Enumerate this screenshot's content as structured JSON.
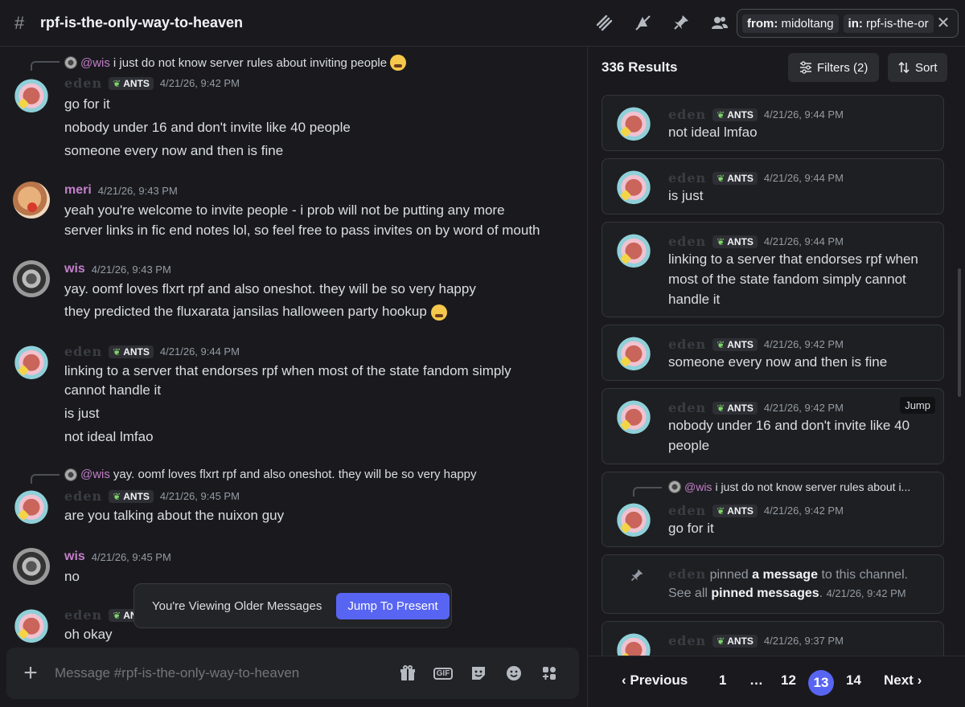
{
  "header": {
    "channel_name": "rpf-is-the-only-way-to-heaven",
    "search_chip_from_label": "from:",
    "search_chip_from_value": "midoltang",
    "search_chip_in_label": "in:",
    "search_chip_in_value": "rpf-is-the-or"
  },
  "chat": {
    "messages": [
      {
        "reply_mention": "@wis",
        "reply_text": "i just do not know server rules about inviting people",
        "author": "eden",
        "tag": "ANTS",
        "timestamp": "4/21/26, 9:42 PM",
        "lines": [
          "go for it",
          "nobody under 16 and don't invite like 40 people",
          "someone every now and then is fine"
        ]
      },
      {
        "author": "meri",
        "timestamp": "4/21/26, 9:43 PM",
        "lines": [
          "yeah you're welcome to invite people - i prob will not be putting any more",
          "server links in fic end notes lol, so feel free to pass invites on by word of mouth"
        ]
      },
      {
        "author": "wis",
        "timestamp": "4/21/26, 9:43 PM",
        "lines": [
          "yay. oomf loves flxrt rpf and also oneshot. they will be so very happy",
          "they predicted the fluxarata jansilas halloween party hookup"
        ]
      },
      {
        "author": "eden",
        "tag": "ANTS",
        "timestamp": "4/21/26, 9:44 PM",
        "lines": [
          "linking to a server that endorses rpf when most of the state fandom simply",
          "cannot handle it",
          "is just",
          "not ideal lmfao"
        ]
      },
      {
        "reply_mention": "@wis",
        "reply_text": "yay. oomf loves flxrt rpf and also oneshot. they will be so very happy",
        "author": "eden",
        "tag": "ANTS",
        "timestamp": "4/21/26, 9:45 PM",
        "lines": [
          "are you talking about the nuixon guy"
        ]
      },
      {
        "author": "wis",
        "timestamp": "4/21/26, 9:45 PM",
        "lines": [
          "no"
        ]
      },
      {
        "author": "eden",
        "tag": "ANT",
        "lines": [
          "oh okay"
        ]
      }
    ],
    "older_notice": "You're Viewing Older Messages",
    "jump_to_present": "Jump To Present",
    "composer_placeholder": "Message #rpf-is-the-only-way-to-heaven",
    "composer_gif": "GIF"
  },
  "results": {
    "count": "336 Results",
    "filters_label": "Filters (2)",
    "sort_label": "Sort",
    "jump_label": "Jump",
    "cards": [
      {
        "author": "eden",
        "tag": "ANTS",
        "timestamp": "4/21/26, 9:44 PM",
        "lines": [
          "not ideal lmfao"
        ]
      },
      {
        "author": "eden",
        "tag": "ANTS",
        "timestamp": "4/21/26, 9:44 PM",
        "lines": [
          "is just"
        ]
      },
      {
        "author": "eden",
        "tag": "ANTS",
        "timestamp": "4/21/26, 9:44 PM",
        "lines": [
          "linking to a server that endorses rpf when",
          "most of the state fandom simply cannot",
          "handle it"
        ]
      },
      {
        "author": "eden",
        "tag": "ANTS",
        "timestamp": "4/21/26, 9:42 PM",
        "lines": [
          "someone every now and then is fine"
        ]
      },
      {
        "author": "eden",
        "tag": "ANTS",
        "timestamp": "4/21/26, 9:42 PM",
        "lines": [
          "nobody under 16 and don't invite like 40",
          "people"
        ]
      },
      {
        "reply_mention": "@wis",
        "reply_text": "i just do not know server rules about i...",
        "author": "eden",
        "tag": "ANTS",
        "timestamp": "4/21/26, 9:42 PM",
        "lines": [
          "go for it"
        ]
      },
      {
        "author": "eden",
        "tag": "ANTS",
        "timestamp": "4/21/26, 9:37 PM",
        "lines": []
      }
    ],
    "pin_card": {
      "actor": "eden",
      "pinned_text": "pinned",
      "message_link": "a message",
      "to_channel": "to this channel.",
      "see_all": "See all",
      "pinned_link": "pinned messages",
      "period": ".",
      "timestamp": "4/21/26, 9:42 PM"
    },
    "pagination": {
      "previous": "Previous",
      "pages": [
        "1",
        "…",
        "12",
        "13",
        "14"
      ],
      "current": "13",
      "next": "Next"
    }
  }
}
